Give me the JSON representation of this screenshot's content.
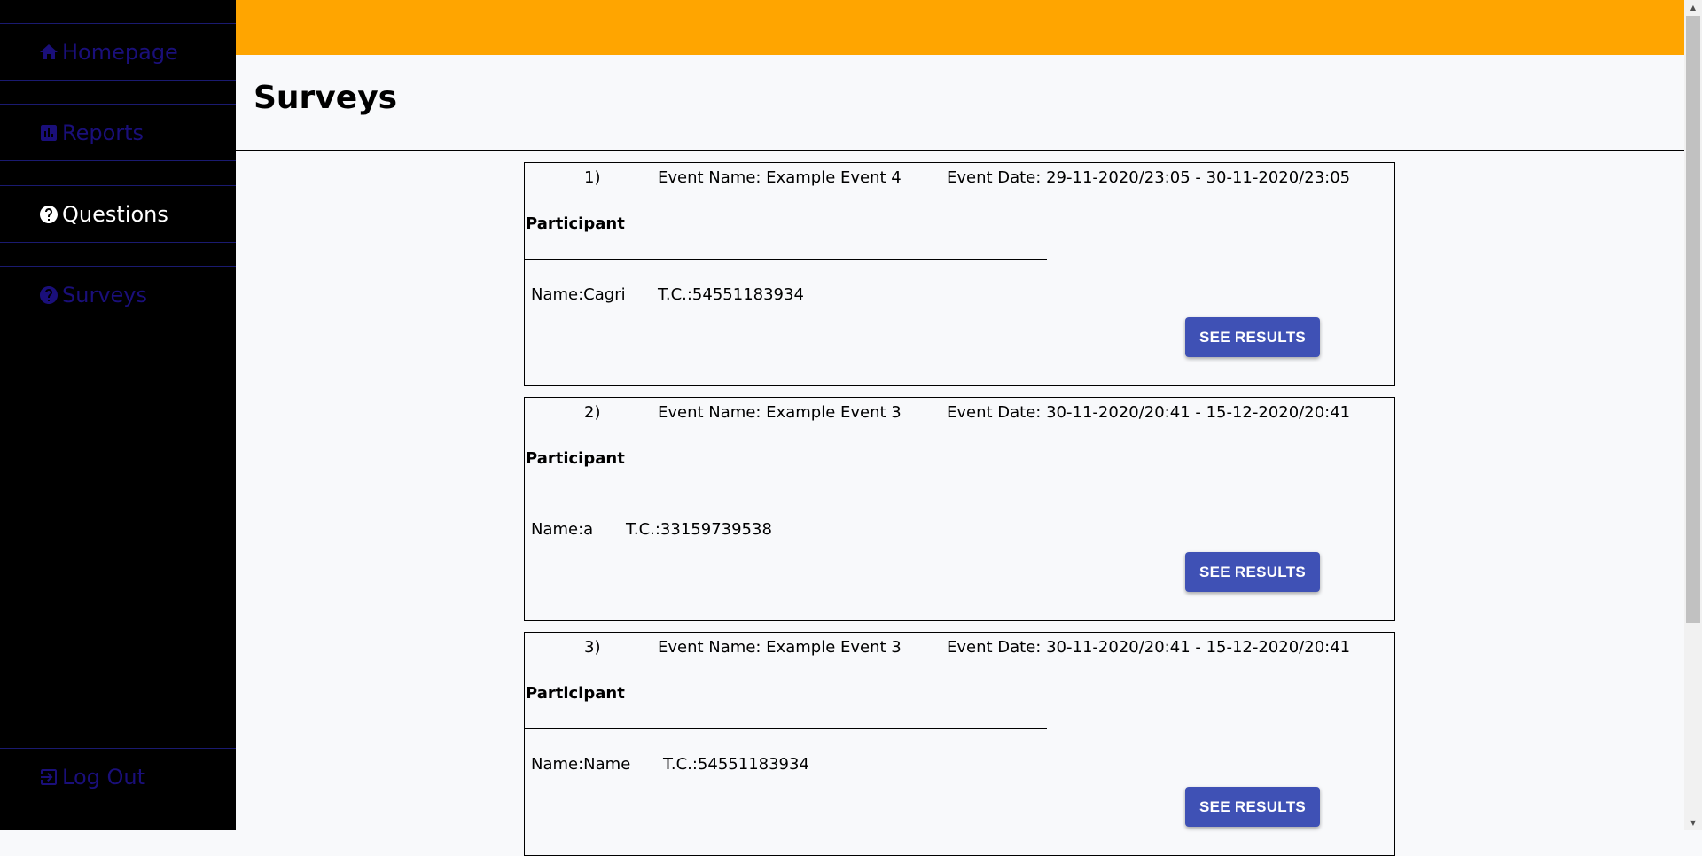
{
  "sidebar": {
    "items": [
      {
        "label": "Homepage",
        "icon": "home-icon",
        "active": false
      },
      {
        "label": "Reports",
        "icon": "bar-chart-icon",
        "active": false
      },
      {
        "label": "Questions",
        "icon": "question-circle-icon",
        "active": true
      },
      {
        "label": "Surveys",
        "icon": "question-circle-icon",
        "active": false
      }
    ],
    "logout": {
      "label": "Log Out",
      "icon": "logout-icon"
    }
  },
  "header": {
    "title": "Surveys"
  },
  "colors": {
    "topbar": "#ffa500",
    "sidebar": "#000000",
    "nav_inactive": "#1a0f7a",
    "button": "#3f51b5"
  },
  "surveys": [
    {
      "number": "1)",
      "event_name": "Event Name: Example Event 4",
      "event_date": "Event Date: 29-11-2020/23:05 - 30-11-2020/23:05",
      "participant_label": "Participant",
      "participant_name": "Name:Cagri",
      "participant_tc": "T.C.:54551183934",
      "button_label": "SEE RESULTS"
    },
    {
      "number": "2)",
      "event_name": "Event Name: Example Event 3",
      "event_date": "Event Date: 30-11-2020/20:41 - 15-12-2020/20:41",
      "participant_label": "Participant",
      "participant_name": "Name:a",
      "participant_tc": "T.C.:33159739538",
      "button_label": "SEE RESULTS"
    },
    {
      "number": "3)",
      "event_name": "Event Name: Example Event 3",
      "event_date": "Event Date: 30-11-2020/20:41 - 15-12-2020/20:41",
      "participant_label": "Participant",
      "participant_name": "Name:Name",
      "participant_tc": "T.C.:54551183934",
      "button_label": "SEE RESULTS"
    }
  ]
}
